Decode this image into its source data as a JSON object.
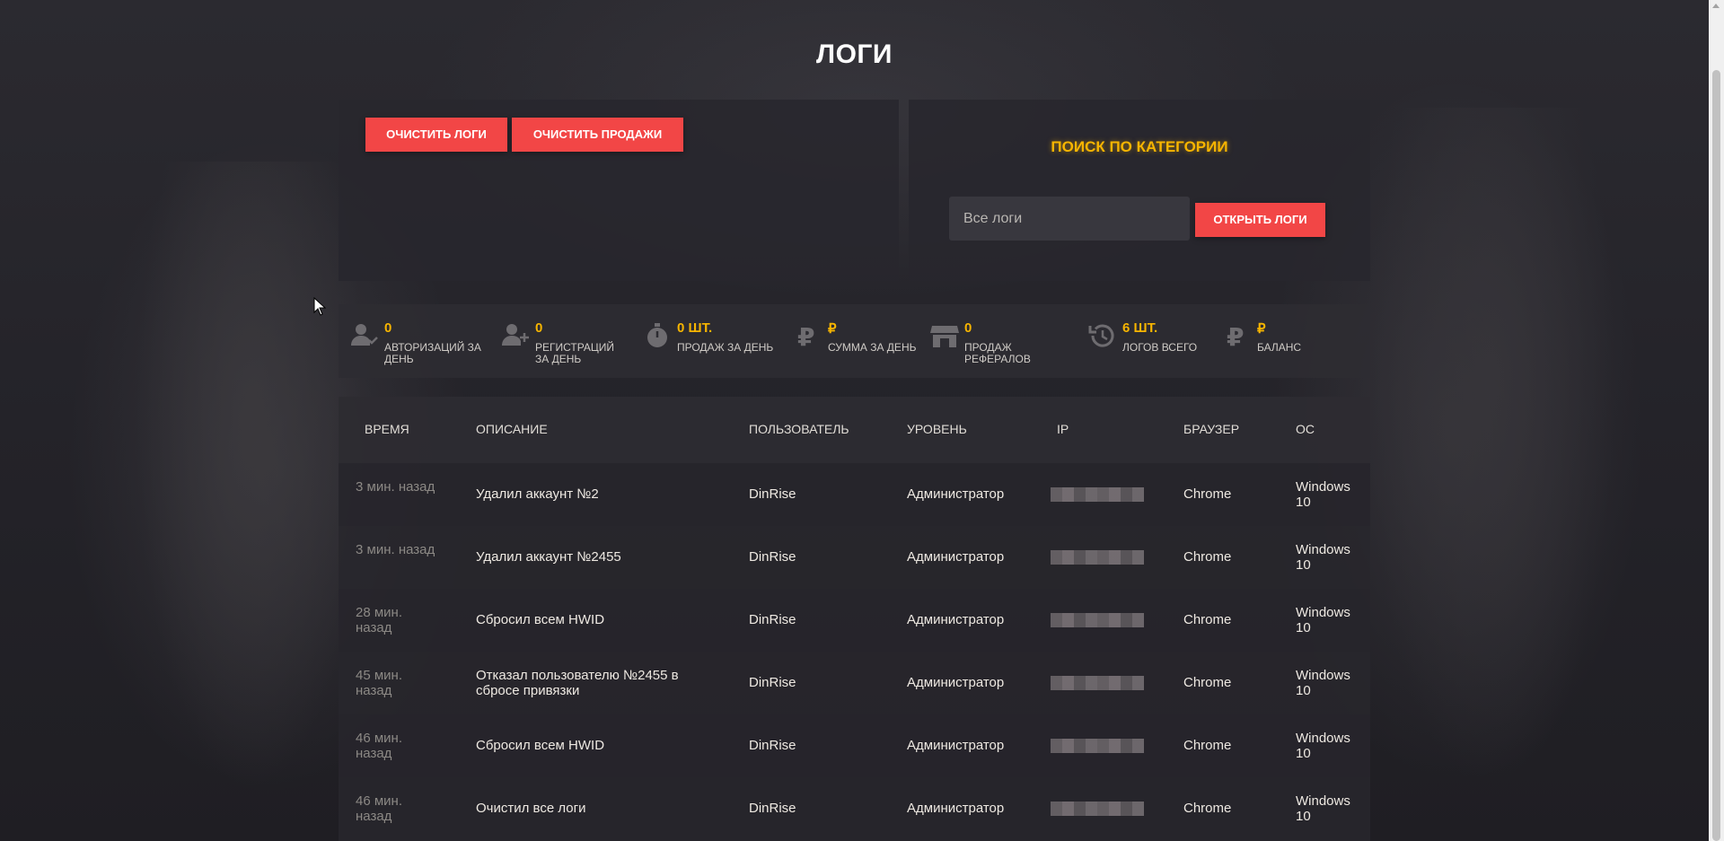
{
  "page": {
    "title": "ЛОГИ"
  },
  "actions": {
    "clear_logs": "ОЧИСТИТЬ ЛОГИ",
    "clear_sales": "ОЧИСТИТЬ ПРОДАЖИ"
  },
  "search": {
    "title": "ПОИСК ПО КАТЕГОРИИ",
    "selected": "Все логи",
    "open_button": "ОТКРЫТЬ ЛОГИ"
  },
  "stats": [
    {
      "icon": "user-check-icon",
      "value": "0",
      "label": "АВТОРИЗАЦИЙ ЗА ДЕНЬ"
    },
    {
      "icon": "user-plus-icon",
      "value": "0",
      "label": "РЕГИСТРАЦИЙ ЗА ДЕНЬ"
    },
    {
      "icon": "stopwatch-icon",
      "value": "0 ШТ.",
      "label": "ПРОДАЖ ЗА ДЕНЬ"
    },
    {
      "icon": "ruble-icon",
      "value": "₽",
      "label": "СУММА ЗА ДЕНЬ"
    },
    {
      "icon": "store-icon",
      "value": "0",
      "label": "ПРОДАЖ РЕФЕРАЛОВ"
    },
    {
      "icon": "history-icon",
      "value": "6 ШТ.",
      "label": "ЛОГОВ ВСЕГО"
    },
    {
      "icon": "ruble-icon",
      "value": "₽",
      "label": "БАЛАНС"
    }
  ],
  "table": {
    "headers": [
      "ВРЕМЯ",
      "ОПИСАНИЕ",
      "ПОЛЬЗОВАТЕЛЬ",
      "УРОВЕНЬ",
      "IP",
      "БРАУЗЕР",
      "ОС"
    ],
    "rows": [
      {
        "time": "3 мин. назад",
        "description": "Удалил аккаунт №2",
        "user": "DinRise",
        "level": "Администратор",
        "browser": "Chrome",
        "os": "Windows 10"
      },
      {
        "time": "3 мин. назад",
        "description": "Удалил аккаунт №2455",
        "user": "DinRise",
        "level": "Администратор",
        "browser": "Chrome",
        "os": "Windows 10"
      },
      {
        "time": "28 мин. назад",
        "description": "Сбросил всем HWID",
        "user": "DinRise",
        "level": "Администратор",
        "browser": "Chrome",
        "os": "Windows 10"
      },
      {
        "time": "45 мин. назад",
        "description": "Отказал пользователю №2455 в сбросе привязки",
        "user": "DinRise",
        "level": "Администратор",
        "browser": "Chrome",
        "os": "Windows 10"
      },
      {
        "time": "46 мин. назад",
        "description": "Сбросил всем HWID",
        "user": "DinRise",
        "level": "Администратор",
        "browser": "Chrome",
        "os": "Windows 10"
      },
      {
        "time": "46 мин. назад",
        "description": "Очистил все логи",
        "user": "DinRise",
        "level": "Администратор",
        "browser": "Chrome",
        "os": "Windows 10"
      }
    ]
  },
  "colors": {
    "accent": "#f24646",
    "highlight": "#f7b500"
  }
}
